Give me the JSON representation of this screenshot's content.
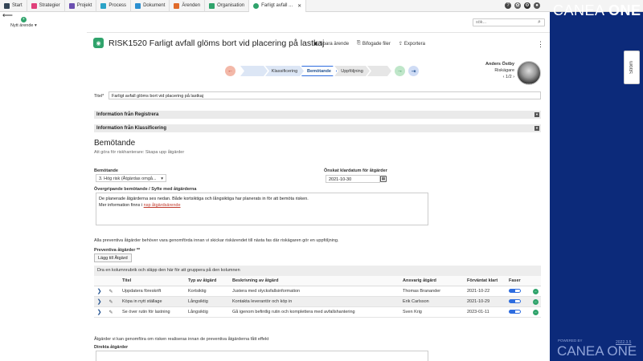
{
  "tabs": [
    {
      "label": "Start",
      "color": "#345"
    },
    {
      "label": "Strategier",
      "color": "#e0407a"
    },
    {
      "label": "Projekt",
      "color": "#6b4fb0"
    },
    {
      "label": "Process",
      "color": "#2aa3c7"
    },
    {
      "label": "Dokument",
      "color": "#2a8fd0"
    },
    {
      "label": "Ärenden",
      "color": "#e06a2a"
    },
    {
      "label": "Organisation",
      "color": "#2fa36b"
    },
    {
      "label": "Farligt avfall ...",
      "color": "#2fa36b"
    }
  ],
  "brand": {
    "name_light": "CANEA ",
    "name_bold": "ONE"
  },
  "left": {
    "new_case": "Nytt ärende"
  },
  "search": {
    "placeholder": "sök..."
  },
  "case": {
    "title": "RISK1520 Farligt avfall glöms bort vid placering på lastkaj",
    "save": "Spara ärende",
    "attach": "Bifogade filer",
    "export": "Exportera"
  },
  "process": {
    "steps": [
      "Klassificering",
      "Bemötande",
      "Uppföljning"
    ]
  },
  "user": {
    "name": "Anders Östby",
    "role": "Riskägare",
    "pager": "1/2"
  },
  "form": {
    "title_label": "Titel*",
    "title_value": "Farligt avfall glöms bort vid placering på lastkaj",
    "section1": "Information från Registrera",
    "section2": "Information från Klassificering",
    "heading": "Bemötande",
    "subheading": "Att göra för riskhanterare: Skapa upp åtgärder",
    "response_label": "Bemötande",
    "response_value": "3. Hög risk (Åtgärdas omgå...",
    "date_label": "Önskat klardatum för åtgärder",
    "date_value": "2021-10-30",
    "purpose_label": "Övergripande bemötande / Syfte med åtgärderna",
    "purpose_text1": "De planerade åtgärderna ses nedan. Både kortsiktiga och långsiktiga har planerats in för att bemöta risken.",
    "purpose_text2": "Mer information finns i ",
    "purpose_link": "nsp åtgärdsärende",
    "all_text": "Alla preventiva åtgärder behöver vara genomförda innan vi skickar riskärendet till nästa fas där riskägaren gör en uppföljning.",
    "preventive_label": "Preventiva åtgärder **",
    "add_button": "Lägg till Åtgärd",
    "direct_text": "Åtgärder vi kan genomföra om risken realiseras innan de preventiva åtgärderna fått effekt",
    "direct_label": "Direkta åtgärder"
  },
  "grid": {
    "group_hint": "Dra en kolumnrubrik och släpp den här för att gruppera på den kolumnen",
    "headers": {
      "title": "Titel",
      "type": "Typ av åtgärd",
      "desc": "Beskrivning av åtgärd",
      "resp": "Ansvarig åtgärd",
      "due": "Förväntat klart",
      "phase": "Faser"
    },
    "rows": [
      {
        "title": "Uppdatera föreskrift",
        "type": "Kortsiktig",
        "desc": "Justera med olycksfallsinformation",
        "resp": "Thomas Branander",
        "due": "2021-10-22",
        "progress": 0.55
      },
      {
        "title": "Köpa in nytt ställage",
        "type": "Långsiktig",
        "desc": "Kontakta leverantör och köp in",
        "resp": "Erik Carlsson",
        "due": "2021-10-29",
        "progress": 0.55
      },
      {
        "title": "Se över rutin för lastning",
        "type": "Långsiktig",
        "desc": "Gå igenom befintlig rutin och komplettera med avfallshantering",
        "resp": "Sven Krig",
        "due": "2023-01-11",
        "progress": 0.55
      }
    ]
  },
  "flow_tab": "Ström",
  "footer": {
    "powered": "POWERED BY",
    "brand": "CANEA ONE",
    "version": "2022.3.5"
  }
}
